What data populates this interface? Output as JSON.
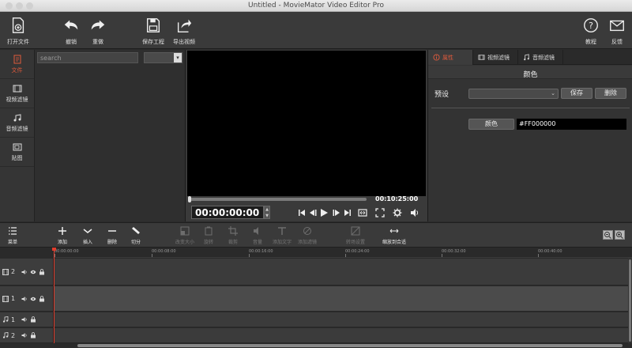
{
  "window": {
    "title": "Untitled - MovieMator Video Editor Pro"
  },
  "toolbar": {
    "open_file": "打开文件",
    "undo": "撤销",
    "redo": "重做",
    "save_project": "保存工程",
    "export_video": "导出视频",
    "tutorial": "教程",
    "feedback": "反馈"
  },
  "leftnav": {
    "items": [
      {
        "label": "文件",
        "icon": "file-icon",
        "active": true
      },
      {
        "label": "视频滤镜",
        "icon": "video-filter-icon"
      },
      {
        "label": "音频滤镜",
        "icon": "audio-filter-icon"
      },
      {
        "label": "贴图",
        "icon": "sticker-icon"
      }
    ]
  },
  "filepanel": {
    "search_placeholder": "search",
    "filter_value": ""
  },
  "viewer": {
    "duration": "00:10:25:00",
    "timecode": "00:00:00:00"
  },
  "properties": {
    "tabs": [
      "属性",
      "视频滤镜",
      "音频滤镜"
    ],
    "title": "颜色",
    "preset_label": "预设",
    "preset_value": "",
    "save": "保存",
    "delete": "删除",
    "color_label": "颜色",
    "color_value": "#FF000000"
  },
  "timeline": {
    "menu": "菜单",
    "add": "添加",
    "insert": "插入",
    "delete": "删除",
    "split": "切分",
    "resize": "改变大小",
    "rotate": "旋转",
    "crop": "裁剪",
    "volume": "音量",
    "add_text": "添加文字",
    "add_filter": "添加滤镜",
    "transition": "转场设置",
    "fit": "缩放到合适",
    "ruler": [
      "00:00:00:00",
      "00:00:08:00",
      "00:00:16:00",
      "00:00:24:00",
      "00:00:32:00",
      "00:00:40:00"
    ],
    "tracks": [
      {
        "type": "video",
        "number": "2"
      },
      {
        "type": "video",
        "number": "1"
      },
      {
        "type": "audio",
        "number": "1"
      },
      {
        "type": "audio",
        "number": "2"
      }
    ]
  },
  "colors": {
    "accent": "#e05a3c",
    "playhead": "#e03c2c"
  }
}
